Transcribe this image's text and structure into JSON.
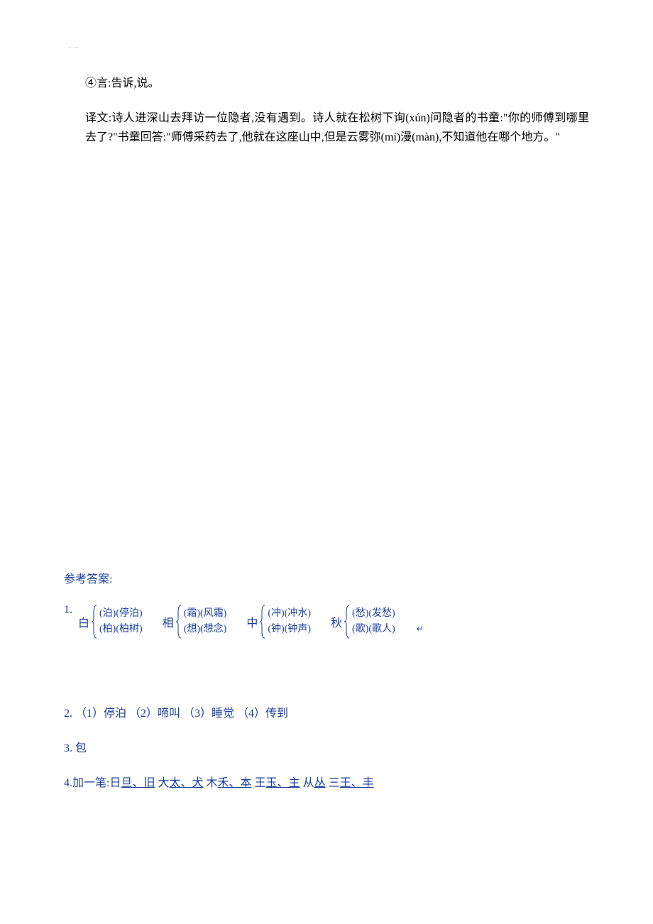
{
  "dots": "……",
  "para1": "④言:告诉,说。",
  "para2": "译文:诗人进深山去拜访一位隐者,没有遇到。诗人就在松树下询(xún)问隐者的书童:\"你的师傅到哪里去了?\"书童回答:\"师傅采药去了,他就在这座山中,但是云雾弥(mí)漫(màn),不知道他在哪个地方。\"",
  "answer_title": "参考答案:",
  "answer1_num": "1.",
  "groups": [
    {
      "label": "白",
      "items": [
        "(泊)(停泊)",
        "(柏)(柏树)"
      ]
    },
    {
      "label": "相",
      "items": [
        "(霜)(风霜)",
        "(想)(想念)"
      ]
    },
    {
      "label": "中",
      "items": [
        "(冲)(冲水)",
        "(钟)(钟声)"
      ]
    },
    {
      "label": "秋",
      "items": [
        "(愁)(发愁)",
        "(歌)(歌人)"
      ]
    }
  ],
  "enter": "↵",
  "answer2": "2. （1）停泊 （2）啼叫 （3）睡觉 （4）传到",
  "answer3": "3.  包",
  "answer4_prefix": "4.加一笔:日",
  "answer4_parts": [
    {
      "u": "旦、旧",
      "plain": "   大"
    },
    {
      "u": "太、犬",
      "plain": "   木"
    },
    {
      "u": "禾、本",
      "plain": "   王"
    },
    {
      "u": "玉、主",
      "plain": "   从"
    },
    {
      "u": "丛",
      "plain": "   三"
    },
    {
      "u": "王、丰",
      "plain": ""
    }
  ]
}
